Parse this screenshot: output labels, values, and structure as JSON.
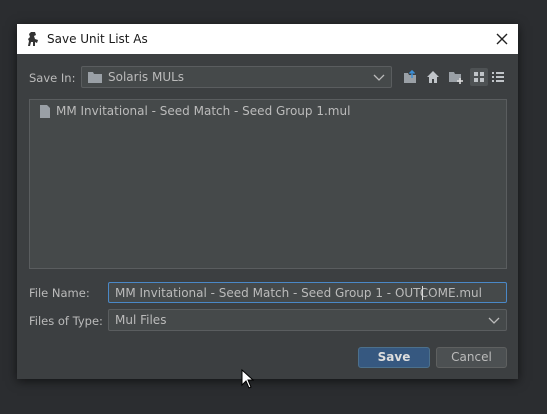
{
  "dialog": {
    "title": "Save Unit List As",
    "icons": {
      "app": "mech-icon",
      "close": "close-icon"
    }
  },
  "save_in": {
    "label": "Save In:",
    "value": "Solaris MULs",
    "icon": "folder-icon"
  },
  "toolbar": {
    "buttons": [
      "up-one-level-icon",
      "home-icon",
      "new-folder-icon",
      "list-view-icon",
      "details-view-icon"
    ],
    "active": "list-view-icon"
  },
  "file_list": {
    "items": [
      {
        "name": "MM Invitational - Seed Match - Seed Group 1.mul",
        "icon": "file-icon"
      }
    ]
  },
  "file_name": {
    "label": "File Name:",
    "value": "MM Invitational - Seed Match - Seed Group 1 - OUTCOME.mul"
  },
  "file_type": {
    "label": "Files of Type:",
    "value": "Mul Files"
  },
  "buttons": {
    "save": "Save",
    "cancel": "Cancel"
  },
  "colors": {
    "background": "#2b2d30",
    "dialog": "#3c3f41",
    "field": "#45494a",
    "accent": "#365880",
    "focus": "#4a88c7"
  }
}
